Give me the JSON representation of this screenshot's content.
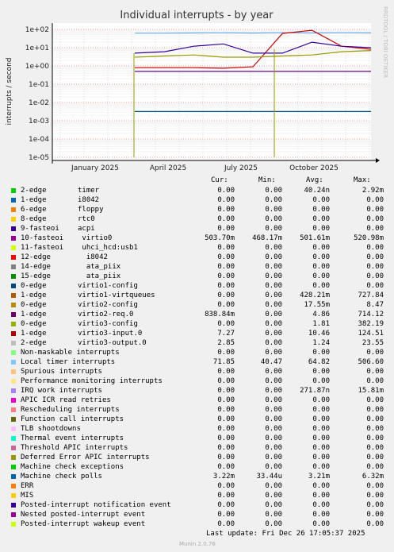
{
  "chart_data": {
    "type": "line",
    "title": "Individual interrupts - by year",
    "ylabel": "interrupts / second",
    "yscale": "log",
    "ylim": [
      1e-05,
      100
    ],
    "y_ticks": [
      {
        "v": 100,
        "label": "1e+02"
      },
      {
        "v": 10,
        "label": "1e+01"
      },
      {
        "v": 1,
        "label": "1e+00"
      },
      {
        "v": 0.1,
        "label": "1e-01"
      },
      {
        "v": 0.01,
        "label": "1e-02"
      },
      {
        "v": 0.001,
        "label": "1e-03"
      },
      {
        "v": 0.0001,
        "label": "1e-04"
      },
      {
        "v": 1e-05,
        "label": "1e-05"
      }
    ],
    "x_ticks": [
      "January 2025",
      "April 2025",
      "July 2025",
      "October 2025"
    ],
    "watermark": "RRDTOOL / TOBI OETIKER",
    "grid": true,
    "series": [
      {
        "name": "Local timer interrupts",
        "color": "#66aaee",
        "values": [
          62,
          62,
          64,
          65,
          63,
          66,
          64,
          66,
          64
        ]
      },
      {
        "name": "virtio2-req.0",
        "color": "#cc0000",
        "values": [
          0.8,
          0.8,
          0.8,
          0.75,
          0.9,
          60,
          90,
          12,
          8
        ]
      },
      {
        "name": "virtio0",
        "color": "#660088",
        "values": [
          0.5,
          0.5,
          0.5,
          0.5,
          0.5,
          0.5,
          0.5,
          0.5,
          0.5
        ]
      },
      {
        "name": "virtio3-input.0",
        "color": "#999900",
        "values": [
          3,
          3.5,
          4,
          3,
          3,
          3.5,
          4,
          6,
          7
        ]
      },
      {
        "name": "IRQ work interrupts",
        "color": "#330099",
        "values": [
          5,
          6,
          12,
          16,
          5,
          5,
          20,
          12,
          10
        ]
      },
      {
        "name": "Machine check polls",
        "color": "#005588",
        "values": [
          0.0032,
          0.0032,
          0.0032,
          0.0032,
          0.0032,
          0.0032,
          0.0032,
          0.0032,
          0.0032
        ]
      }
    ]
  },
  "legend": {
    "headers": {
      "cur": "Cur:",
      "min": "Min:",
      "avg": "Avg:",
      "max": "Max:"
    },
    "rows": [
      {
        "color": "#00cc00",
        "name": "2-edge",
        "name2": "timer",
        "cur": "0.00",
        "min": "0.00",
        "avg": "40.24n",
        "max": "2.92m"
      },
      {
        "color": "#0066b3",
        "name": "1-edge",
        "name2": "i8042",
        "cur": "0.00",
        "min": "0.00",
        "avg": "0.00",
        "max": "0.00"
      },
      {
        "color": "#ff8000",
        "name": "6-edge",
        "name2": "floppy",
        "cur": "0.00",
        "min": "0.00",
        "avg": "0.00",
        "max": "0.00"
      },
      {
        "color": "#ffcc00",
        "name": "8-edge",
        "name2": "rtc0",
        "cur": "0.00",
        "min": "0.00",
        "avg": "0.00",
        "max": "0.00"
      },
      {
        "color": "#330099",
        "name": "9-fasteoi",
        "name2": "acpi",
        "cur": "0.00",
        "min": "0.00",
        "avg": "0.00",
        "max": "0.00"
      },
      {
        "color": "#990099",
        "name": "10-fasteoi",
        "name2": " virtio0",
        "cur": "503.70m",
        "min": "468.17m",
        "avg": "501.61m",
        "max": "520.98m"
      },
      {
        "color": "#ccff00",
        "name": "11-fasteoi",
        "name2": " uhci_hcd:usb1",
        "cur": "0.00",
        "min": "0.00",
        "avg": "0.00",
        "max": "0.00"
      },
      {
        "color": "#ff0000",
        "name": "12-edge",
        "name2": "  i8042",
        "cur": "0.00",
        "min": "0.00",
        "avg": "0.00",
        "max": "0.00"
      },
      {
        "color": "#808080",
        "name": "14-edge",
        "name2": "  ata_piix",
        "cur": "0.00",
        "min": "0.00",
        "avg": "0.00",
        "max": "0.00"
      },
      {
        "color": "#008f00",
        "name": "15-edge",
        "name2": "  ata_piix",
        "cur": "0.00",
        "min": "0.00",
        "avg": "0.00",
        "max": "0.00"
      },
      {
        "color": "#00487d",
        "name": "0-edge",
        "name2": "virtio1-config",
        "cur": "0.00",
        "min": "0.00",
        "avg": "0.00",
        "max": "0.00"
      },
      {
        "color": "#b35a00",
        "name": "1-edge",
        "name2": "virtio1-virtqueues",
        "cur": "0.00",
        "min": "0.00",
        "avg": "428.21m",
        "max": "727.84"
      },
      {
        "color": "#b38f00",
        "name": "0-edge",
        "name2": "virtio2-config",
        "cur": "0.00",
        "min": "0.00",
        "avg": "17.55m",
        "max": "8.47"
      },
      {
        "color": "#6b006b",
        "name": "1-edge",
        "name2": "virtio2-req.0",
        "cur": "838.84m",
        "min": "0.00",
        "avg": "4.86",
        "max": "714.12"
      },
      {
        "color": "#8fb300",
        "name": "0-edge",
        "name2": "virtio3-config",
        "cur": "0.00",
        "min": "0.00",
        "avg": "1.81",
        "max": "382.19"
      },
      {
        "color": "#b30000",
        "name": "1-edge",
        "name2": "virtio3-input.0",
        "cur": "7.27",
        "min": "0.00",
        "avg": "10.46",
        "max": "124.51"
      },
      {
        "color": "#bebebe",
        "name": "2-edge",
        "name2": "virtio3-output.0",
        "cur": "2.85",
        "min": "0.00",
        "avg": "1.24",
        "max": "23.55"
      },
      {
        "color": "#80ff80",
        "name": "Non-maskable interrupts",
        "name2": "",
        "cur": "0.00",
        "min": "0.00",
        "avg": "0.00",
        "max": "0.00"
      },
      {
        "color": "#80c9ff",
        "name": "Local timer interrupts",
        "name2": "",
        "cur": "71.85",
        "min": "40.47",
        "avg": "64.82",
        "max": "506.60"
      },
      {
        "color": "#ffc080",
        "name": "Spurious interrupts",
        "name2": "",
        "cur": "0.00",
        "min": "0.00",
        "avg": "0.00",
        "max": "0.00"
      },
      {
        "color": "#ffe680",
        "name": "Performance monitoring interrupts",
        "name2": "",
        "cur": "0.00",
        "min": "0.00",
        "avg": "0.00",
        "max": "0.00"
      },
      {
        "color": "#aa80ff",
        "name": "IRQ work interrupts",
        "name2": "",
        "cur": "0.00",
        "min": "0.00",
        "avg": "271.87n",
        "max": "15.81m"
      },
      {
        "color": "#ee00cc",
        "name": "APIC ICR read retries",
        "name2": "",
        "cur": "0.00",
        "min": "0.00",
        "avg": "0.00",
        "max": "0.00"
      },
      {
        "color": "#ff8080",
        "name": "Rescheduling interrupts",
        "name2": "",
        "cur": "0.00",
        "min": "0.00",
        "avg": "0.00",
        "max": "0.00"
      },
      {
        "color": "#666600",
        "name": "Function call interrupts",
        "name2": "",
        "cur": "0.00",
        "min": "0.00",
        "avg": "0.00",
        "max": "0.00"
      },
      {
        "color": "#ffbfff",
        "name": "TLB shootdowns",
        "name2": "",
        "cur": "0.00",
        "min": "0.00",
        "avg": "0.00",
        "max": "0.00"
      },
      {
        "color": "#00ffcc",
        "name": "Thermal event interrupts",
        "name2": "",
        "cur": "0.00",
        "min": "0.00",
        "avg": "0.00",
        "max": "0.00"
      },
      {
        "color": "#cc6699",
        "name": "Threshold APIC interrupts",
        "name2": "",
        "cur": "0.00",
        "min": "0.00",
        "avg": "0.00",
        "max": "0.00"
      },
      {
        "color": "#999900",
        "name": "Deferred Error APIC interrupts",
        "name2": "",
        "cur": "0.00",
        "min": "0.00",
        "avg": "0.00",
        "max": "0.00"
      },
      {
        "color": "#00cc00",
        "name": "Machine check exceptions",
        "name2": "",
        "cur": "0.00",
        "min": "0.00",
        "avg": "0.00",
        "max": "0.00"
      },
      {
        "color": "#0066b3",
        "name": "Machine check polls",
        "name2": "",
        "cur": "3.22m",
        "min": "33.44u",
        "avg": "3.21m",
        "max": "6.32m"
      },
      {
        "color": "#ff8000",
        "name": "ERR",
        "name2": "",
        "cur": "0.00",
        "min": "0.00",
        "avg": "0.00",
        "max": "0.00"
      },
      {
        "color": "#ffcc00",
        "name": "MIS",
        "name2": "",
        "cur": "0.00",
        "min": "0.00",
        "avg": "0.00",
        "max": "0.00"
      },
      {
        "color": "#330099",
        "name": "Posted-interrupt notification event",
        "name2": "",
        "cur": "0.00",
        "min": "0.00",
        "avg": "0.00",
        "max": "0.00"
      },
      {
        "color": "#990099",
        "name": "Nested posted-interrupt event",
        "name2": "",
        "cur": "0.00",
        "min": "0.00",
        "avg": "0.00",
        "max": "0.00"
      },
      {
        "color": "#ccff00",
        "name": "Posted-interrupt wakeup event",
        "name2": "",
        "cur": "0.00",
        "min": "0.00",
        "avg": "0.00",
        "max": "0.00"
      }
    ]
  },
  "footer": {
    "last_update": "Last update: Fri Dec 26 17:05:37 2025",
    "munin": "Munin 2.0.76"
  }
}
